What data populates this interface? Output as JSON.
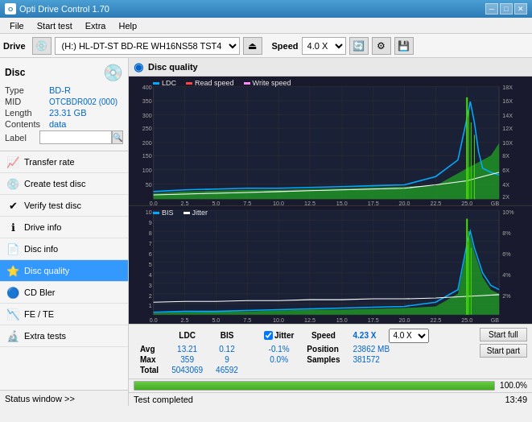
{
  "titlebar": {
    "title": "Opti Drive Control 1.70",
    "min_btn": "─",
    "max_btn": "□",
    "close_btn": "✕"
  },
  "menubar": {
    "items": [
      "File",
      "Start test",
      "Extra",
      "Help"
    ]
  },
  "toolbar": {
    "drive_label": "Drive",
    "drive_value": "(H:) HL-DT-ST BD-RE  WH16NS58 TST4",
    "speed_label": "Speed",
    "speed_value": "4.0 X"
  },
  "disc_panel": {
    "title": "Disc",
    "type_label": "Type",
    "type_value": "BD-R",
    "mid_label": "MID",
    "mid_value": "OTCBDR002 (000)",
    "length_label": "Length",
    "length_value": "23.31 GB",
    "contents_label": "Contents",
    "contents_value": "data",
    "label_label": "Label"
  },
  "nav_items": [
    {
      "id": "transfer-rate",
      "label": "Transfer rate",
      "icon": "📈"
    },
    {
      "id": "create-test-disc",
      "label": "Create test disc",
      "icon": "💿"
    },
    {
      "id": "verify-test-disc",
      "label": "Verify test disc",
      "icon": "✔"
    },
    {
      "id": "drive-info",
      "label": "Drive info",
      "icon": "ℹ"
    },
    {
      "id": "disc-info",
      "label": "Disc info",
      "icon": "📄"
    },
    {
      "id": "disc-quality",
      "label": "Disc quality",
      "icon": "⭐",
      "active": true
    },
    {
      "id": "cd-bler",
      "label": "CD Bler",
      "icon": "🔵"
    },
    {
      "id": "fe-te",
      "label": "FE / TE",
      "icon": "📉"
    },
    {
      "id": "extra-tests",
      "label": "Extra tests",
      "icon": "🔬"
    }
  ],
  "status_window_btn": "Status window >>",
  "disc_quality": {
    "title": "Disc quality",
    "legend": {
      "ldc": "LDC",
      "read_speed": "Read speed",
      "write_speed": "Write speed",
      "bis": "BIS",
      "jitter": "Jitter"
    },
    "top_chart": {
      "y_max": 400,
      "y_labels": [
        400,
        350,
        300,
        250,
        200,
        150,
        100,
        50
      ],
      "x_labels": [
        0.0,
        2.5,
        5.0,
        7.5,
        10.0,
        12.5,
        15.0,
        17.5,
        20.0,
        22.5,
        25.0
      ],
      "right_y_labels": [
        "18X",
        "16X",
        "14X",
        "12X",
        "10X",
        "8X",
        "6X",
        "4X",
        "2X"
      ]
    },
    "bottom_chart": {
      "y_max": 10,
      "y_labels": [
        10,
        9,
        8,
        7,
        6,
        5,
        4,
        3,
        2,
        1
      ],
      "right_y_labels": [
        "10%",
        "8%",
        "6%",
        "4%",
        "2%"
      ]
    },
    "stats": {
      "avg_ldc": "13.21",
      "avg_bis": "0.12",
      "avg_jitter": "-0.1%",
      "max_ldc": "359",
      "max_bis": "9",
      "max_jitter": "0.0%",
      "total_ldc": "5043069",
      "total_bis": "46592",
      "speed_label": "Speed",
      "speed_value": "4.23 X",
      "speed_select": "4.0 X",
      "position_label": "Position",
      "position_value": "23862 MB",
      "samples_label": "Samples",
      "samples_value": "381572",
      "jitter_checked": true
    },
    "buttons": {
      "start_full": "Start full",
      "start_part": "Start part"
    }
  },
  "progress": {
    "value": 100,
    "label": "100.0%"
  },
  "bottom_status": {
    "text": "Test completed",
    "time": "13:49"
  }
}
